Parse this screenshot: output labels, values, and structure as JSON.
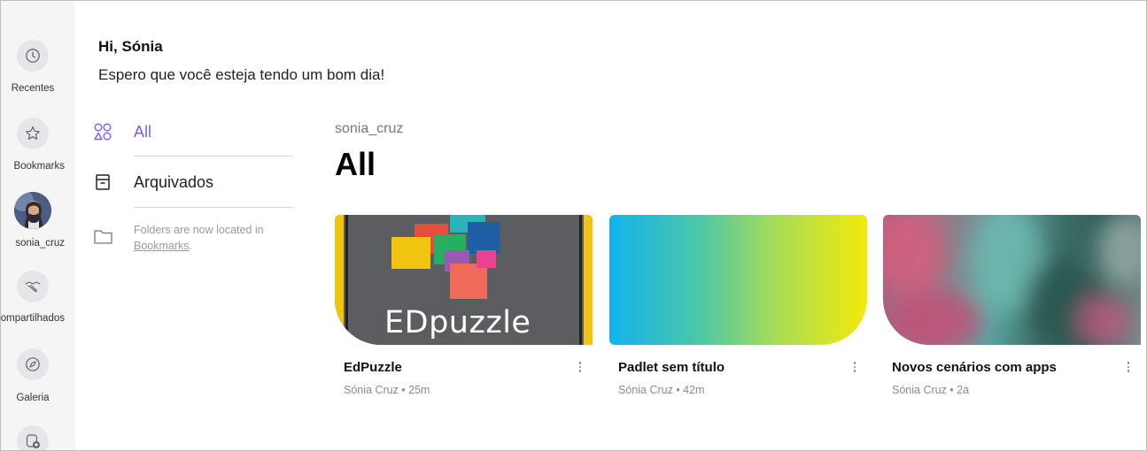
{
  "rail": {
    "items": [
      {
        "label": "Recentes",
        "icon": "clock-icon"
      },
      {
        "label": "Bookmarks",
        "icon": "star-icon"
      },
      {
        "label": "sonia_cruz",
        "icon": "avatar"
      },
      {
        "label": "Compartilhados",
        "icon": "handshake-icon"
      },
      {
        "label": "Galeria",
        "icon": "compass-icon"
      },
      {
        "label": "",
        "icon": "new-padlet-icon"
      }
    ]
  },
  "greeting": {
    "name": "Hi, Sónia",
    "message": "Espero que você esteja tendo um bom dia!"
  },
  "filters": {
    "all_label": "All",
    "archived_label": "Arquivados",
    "folders_note": "Folders are now located in",
    "folders_link": "Bookmarks",
    "folders_period": "."
  },
  "main": {
    "owner": "sonia_cruz",
    "title": "All"
  },
  "cards": [
    {
      "title": "EdPuzzle",
      "meta": "Sónia Cruz • 25m",
      "thumb_text": "EDpuzzle"
    },
    {
      "title": "Padlet sem título",
      "meta": "Sónia Cruz • 42m"
    },
    {
      "title": "Novos cenários com apps",
      "meta": "Sónia Cruz • 2a"
    }
  ],
  "colors": {
    "accent": "#7c5cf0",
    "rail_bg": "#f5f5f6",
    "meta_text": "#8a8a8a"
  }
}
